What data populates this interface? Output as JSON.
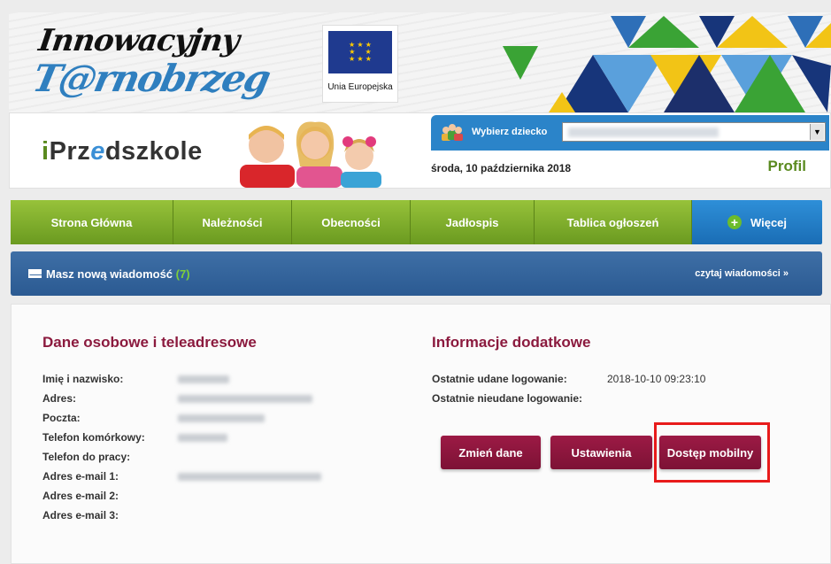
{
  "banner": {
    "logo_line1": "Innowacyjny",
    "logo_line2": "T@rnobrzeg",
    "eu_label": "Unia Europejska"
  },
  "header": {
    "brand_prefix": "i",
    "brand_part1": "Prz",
    "brand_e": "e",
    "brand_part2": "dszkole",
    "child_label": "Wybierz dziecko",
    "date": "środa, 10 października 2018",
    "profile_link": "Profil"
  },
  "nav": {
    "items": [
      {
        "label": "Strona Główna"
      },
      {
        "label": "Należności"
      },
      {
        "label": "Obecności"
      },
      {
        "label": "Jadłospis"
      },
      {
        "label": "Tablica ogłoszeń"
      }
    ],
    "more_label": "Więcej"
  },
  "messages": {
    "text": "Masz nową wiadomość",
    "count": "(7)",
    "read_link": "czytaj wiadomości »"
  },
  "personal": {
    "title": "Dane osobowe i teleadresowe",
    "fields": [
      {
        "label": "Imię i nazwisko:"
      },
      {
        "label": "Adres:"
      },
      {
        "label": "Poczta:"
      },
      {
        "label": "Telefon komórkowy:"
      },
      {
        "label": "Telefon do pracy:"
      },
      {
        "label": "Adres e-mail 1:"
      },
      {
        "label": "Adres e-mail 2:"
      },
      {
        "label": "Adres e-mail 3:"
      }
    ]
  },
  "extra": {
    "title": "Informacje dodatkowe",
    "last_success_label": "Ostatnie udane logowanie:",
    "last_success_value": "2018-10-10 09:23:10",
    "last_fail_label": "Ostatnie nieudane logowanie:"
  },
  "buttons": {
    "change": "Zmień dane",
    "settings": "Ustawienia",
    "mobile": "Dostęp mobilny"
  },
  "colors": {
    "green": "#7aaa27",
    "blue": "#2b84c9",
    "maroon": "#8b1a3e",
    "highlight": "#e81b1b"
  }
}
